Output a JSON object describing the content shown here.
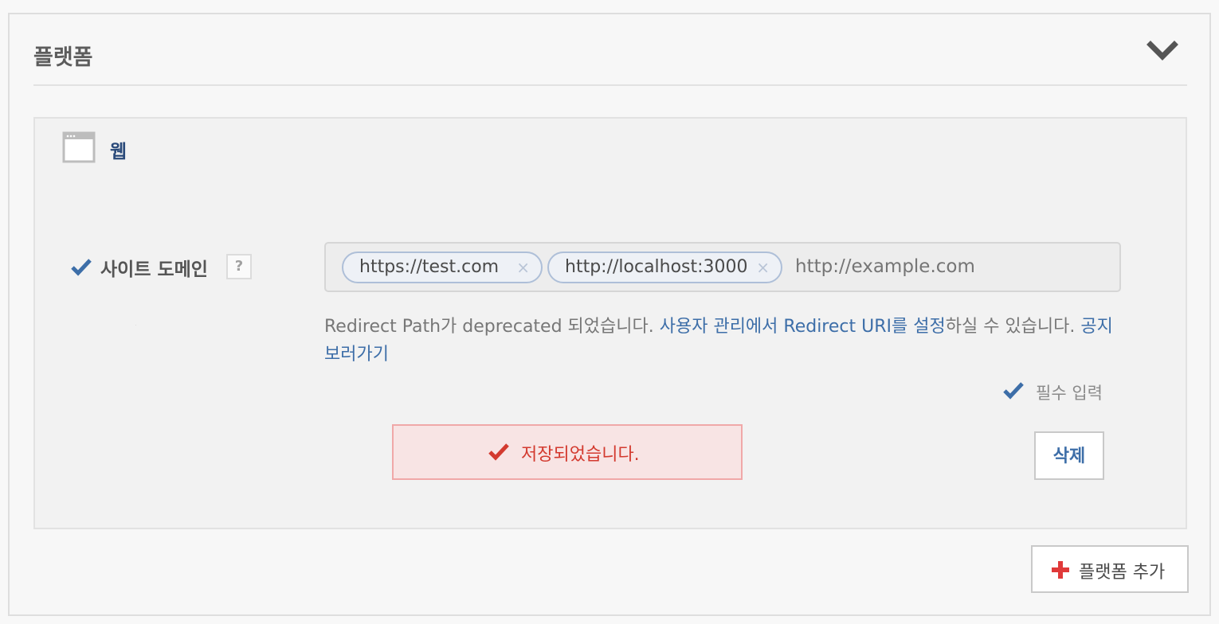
{
  "panel": {
    "title": "플랫폼",
    "collapse_icon": "chevron-down-icon"
  },
  "platform": {
    "icon": "browser-window-icon",
    "name": "웹",
    "site_domain": {
      "label": "사이트 도메인",
      "help": "?",
      "tags": [
        {
          "value": "https://test.com",
          "remove": "×"
        },
        {
          "value": "http://localhost:3000",
          "remove": "×"
        }
      ],
      "placeholder": "http://example.com"
    },
    "notice": {
      "text_1": "Redirect Path가 deprecated 되었습니다. ",
      "link_1": "사용자 관리에서 Redirect URI를 설정",
      "text_2": "하실 수 있습니다. ",
      "link_2": "공지 보러가기"
    },
    "required_legend": "필수 입력",
    "saved_message": "저장되었습니다.",
    "delete_label": "삭제"
  },
  "add_platform_label": "플랫폼 추가",
  "colors": {
    "check_blue": "#3d6ea8",
    "saved_red": "#d33a2f",
    "add_red": "#e03a3a"
  }
}
